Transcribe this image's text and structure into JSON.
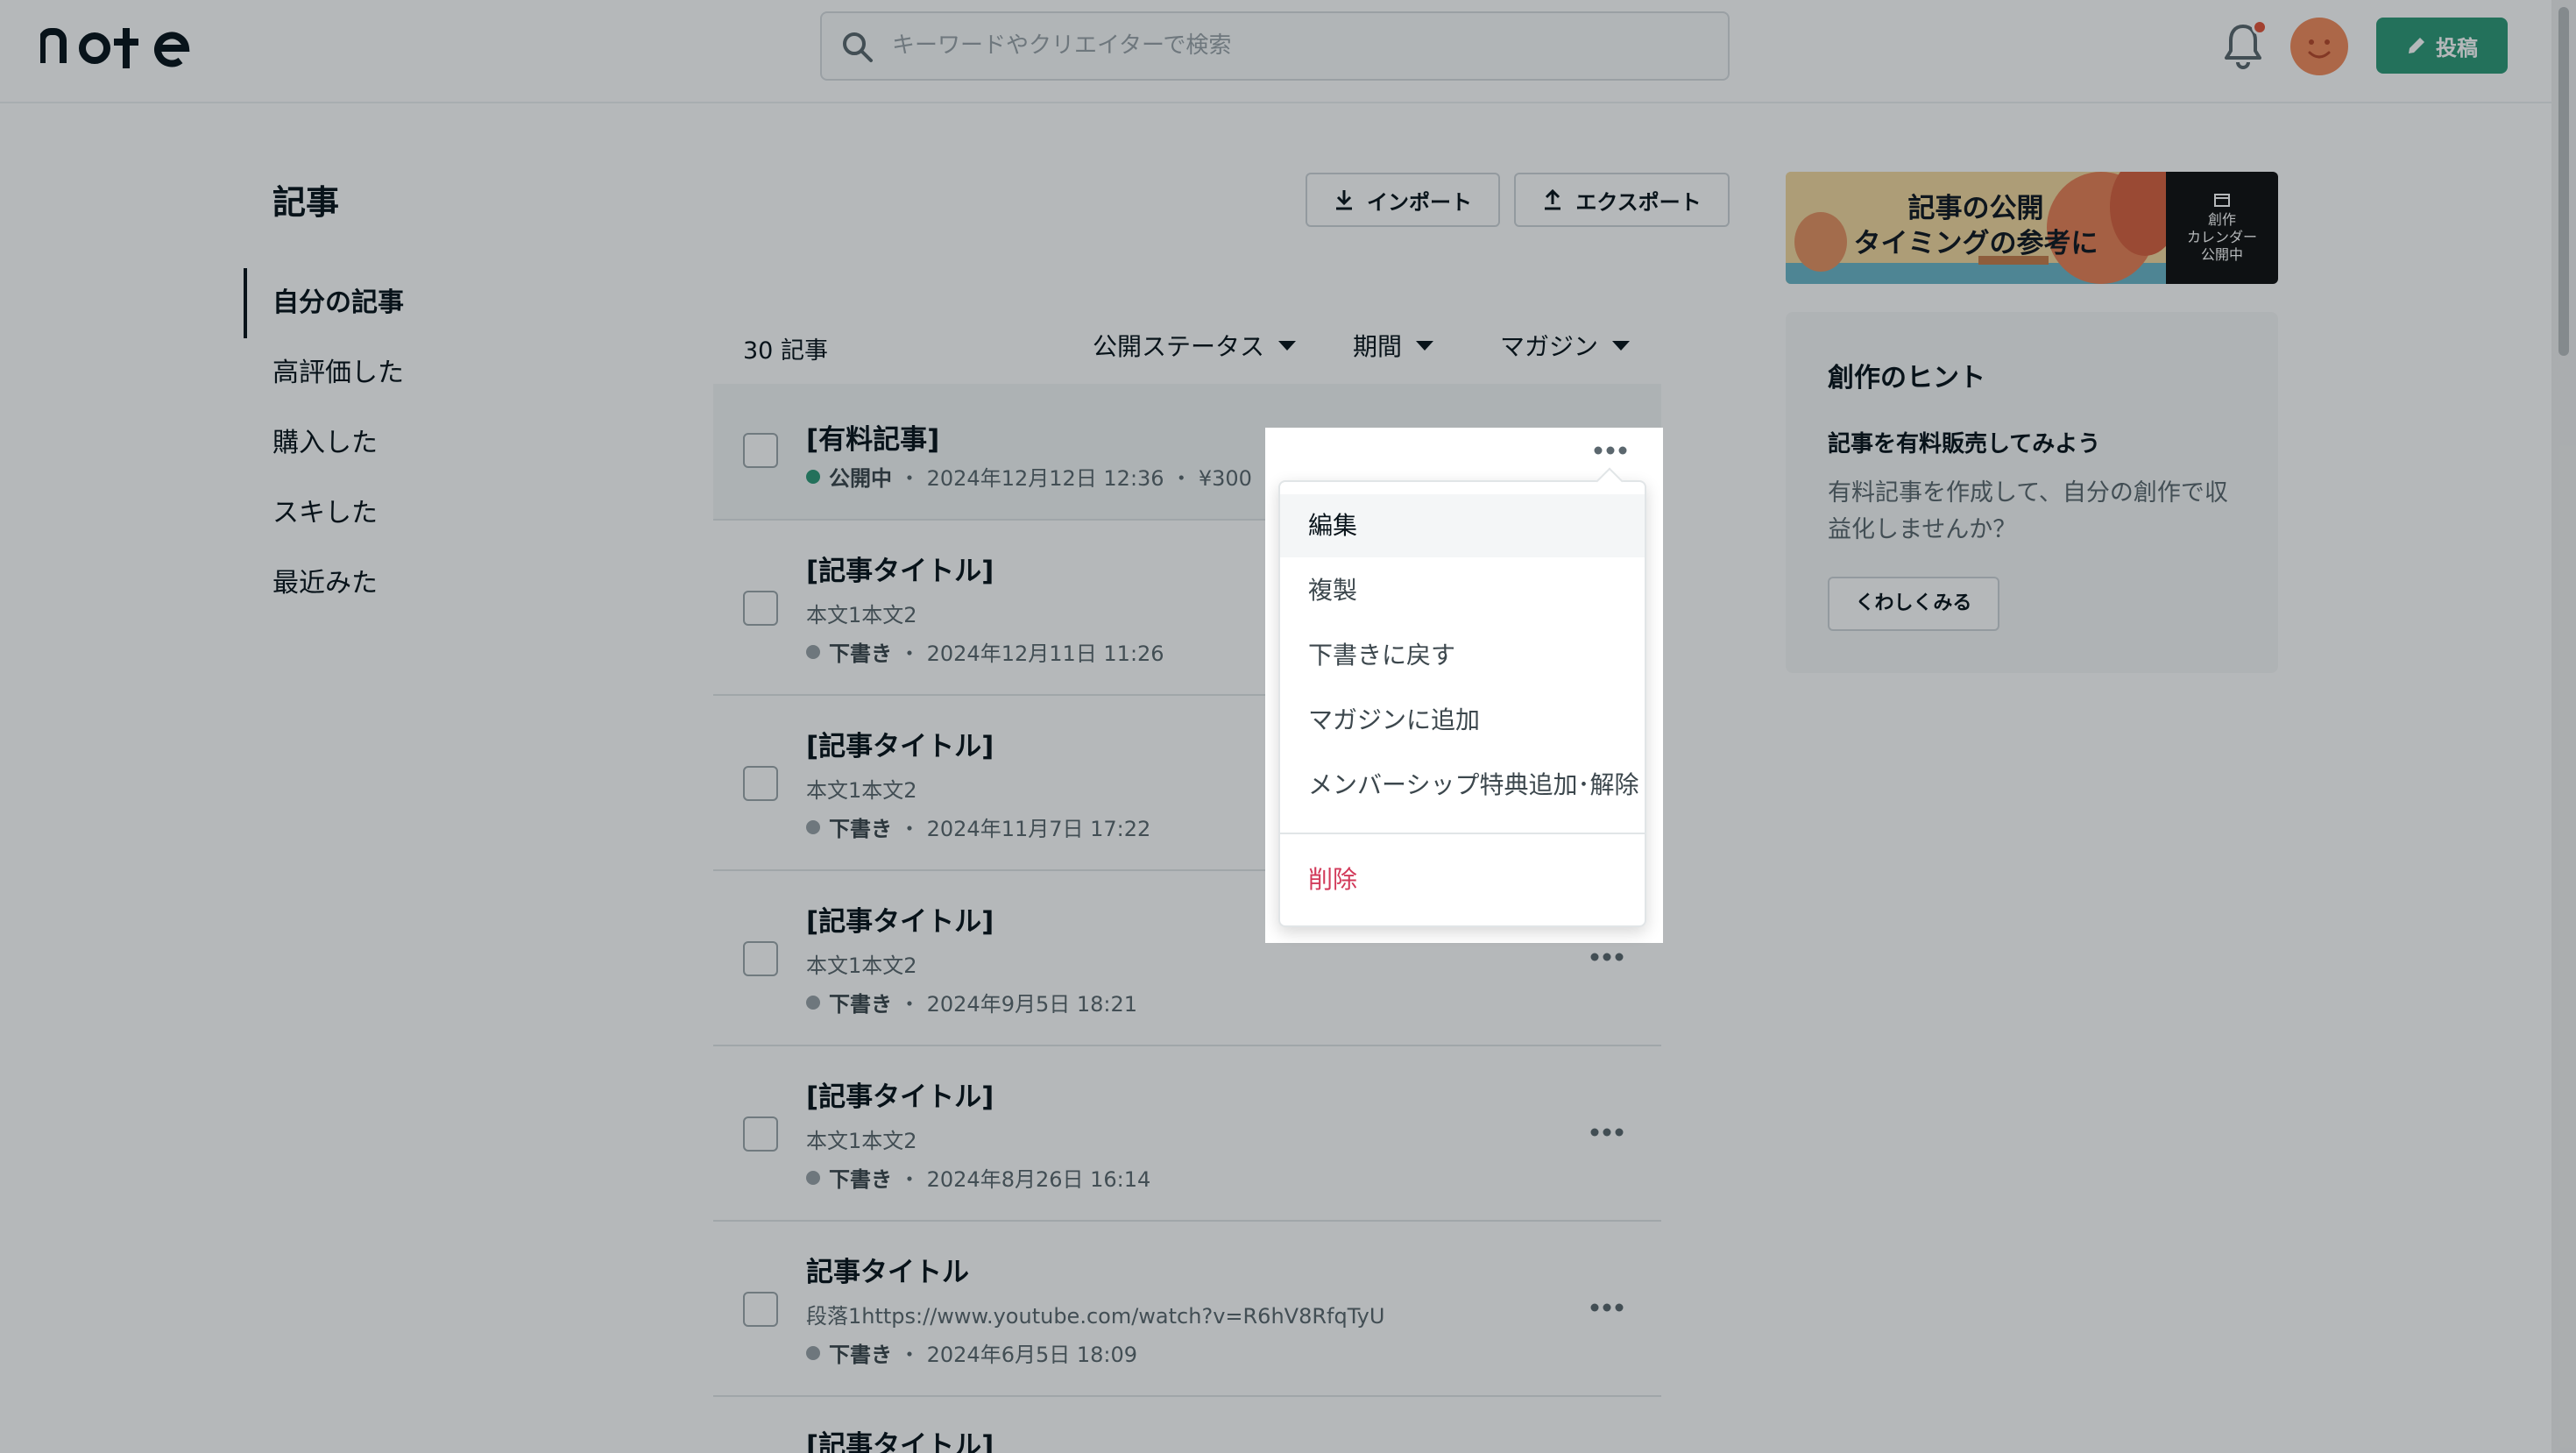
{
  "header": {
    "search_placeholder": "キーワードやクリエイターで検索",
    "post_label": "投稿",
    "colors": {
      "accent": "#2e9a78",
      "notification": "#e4553a"
    }
  },
  "sidebar": {
    "title": "記事",
    "items": [
      {
        "label": "自分の記事",
        "active": true
      },
      {
        "label": "高評価した"
      },
      {
        "label": "購入した"
      },
      {
        "label": "スキした"
      },
      {
        "label": "最近みた"
      }
    ]
  },
  "toolbar": {
    "import_label": "インポート",
    "export_label": "エクスポート"
  },
  "articles": {
    "count": "30 記事",
    "filters": [
      "公開ステータス",
      "期間",
      "マガジン"
    ],
    "rows": [
      {
        "title": "[有料記事]",
        "status": "公開中",
        "meta": "・ 2024年12月12日 12:36 ・ ¥300"
      },
      {
        "title": "[記事タイトル]",
        "body": "本文1本文2",
        "status": "下書き",
        "meta": "・ 2024年12月11日 11:26"
      },
      {
        "title": "[記事タイトル]",
        "body": "本文1本文2",
        "status": "下書き",
        "meta": "・ 2024年11月7日 17:22"
      },
      {
        "title": "[記事タイトル]",
        "body": "本文1本文2",
        "status": "下書き",
        "meta": "・ 2024年9月5日 18:21"
      },
      {
        "title": "[記事タイトル]",
        "body": "本文1本文2",
        "status": "下書き",
        "meta": "・ 2024年8月26日 16:14"
      },
      {
        "title": "記事タイトル",
        "body": "段落1https://www.youtube.com/watch?v=R6hV8RfqTyU",
        "status": "下書き",
        "meta": "・ 2024年6月5日 18:09"
      },
      {
        "title": "[記事タイトル]"
      }
    ]
  },
  "menu": {
    "items": [
      "編集",
      "複製",
      "下書きに戻す",
      "マガジンに追加",
      "メンバーシップ特典追加･解除"
    ],
    "delete_label": "削除"
  },
  "sidebar_right": {
    "banner_text": [
      "記事の公開",
      "タイミングの参考に"
    ],
    "banner_side": [
      "創作",
      "カレンダー",
      "公開中"
    ],
    "hint_title": "創作のヒント",
    "hint_subtitle": "記事を有料販売してみよう",
    "hint_body": "有料記事を作成して、自分の創作で収益化しませんか？",
    "hint_button": "くわしくみる"
  }
}
